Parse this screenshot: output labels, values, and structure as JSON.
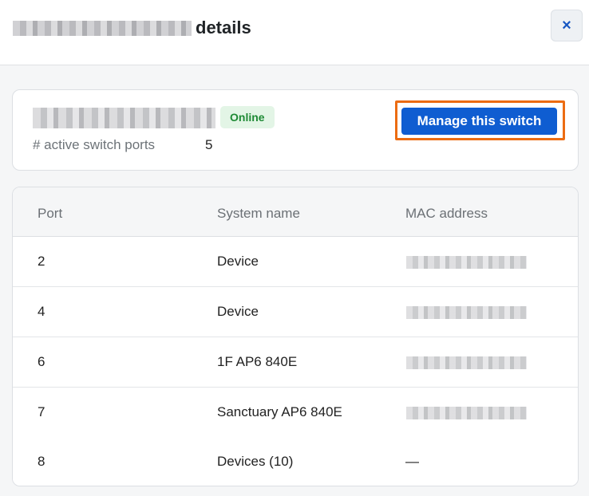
{
  "header": {
    "title_suffix": "details",
    "close_label": "×"
  },
  "switch_card": {
    "status": "Online",
    "active_ports_label": "# active switch ports",
    "active_ports_value": "5",
    "manage_label": "Manage this switch",
    "status_color": "#1e8a35",
    "accent_color": "#0f5dd1",
    "highlight_color": "#ec6c12"
  },
  "table": {
    "headers": [
      "Port",
      "System name",
      "MAC address"
    ],
    "rows": [
      {
        "port": "2",
        "system": "Device",
        "mac": ""
      },
      {
        "port": "4",
        "system": "Device",
        "mac": ""
      },
      {
        "port": "6",
        "system": "1F AP6 840E",
        "mac": ""
      },
      {
        "port": "7",
        "system": "Sanctuary AP6 840E",
        "mac": ""
      },
      {
        "port": "8",
        "system": "Devices (10)",
        "mac": "—"
      }
    ]
  }
}
